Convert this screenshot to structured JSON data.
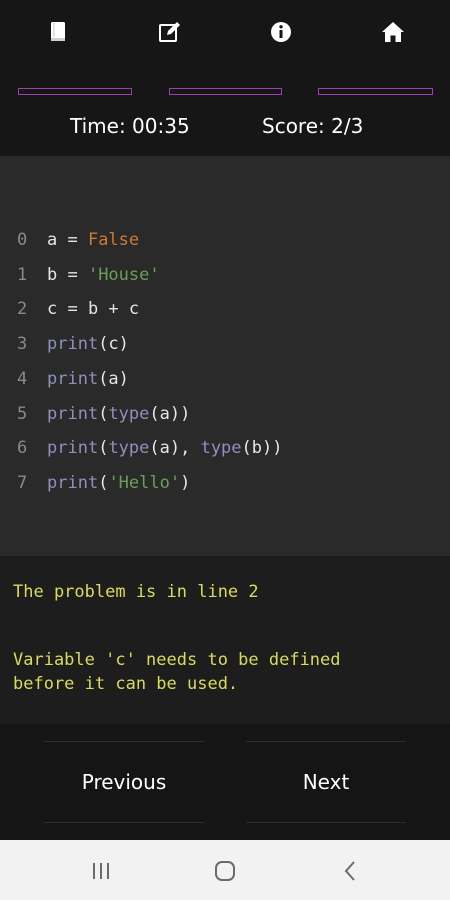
{
  "toolbar": {
    "icons": [
      "book-icon",
      "edit-icon",
      "info-icon",
      "home-icon"
    ]
  },
  "progress": {
    "segments": 3,
    "color": "#9b3fb2"
  },
  "status": {
    "time": "Time: 00:35",
    "score": "Score: 2/3"
  },
  "code": {
    "line_numbers": [
      "0",
      "1",
      "2",
      "3",
      "4",
      "5",
      "6",
      "7"
    ],
    "lines": [
      [
        {
          "t": "a = ",
          "c": "plain"
        },
        {
          "t": "False",
          "c": "kw"
        }
      ],
      [
        {
          "t": "b = ",
          "c": "plain"
        },
        {
          "t": "'House'",
          "c": "str"
        }
      ],
      [
        {
          "t": "c = b + c",
          "c": "plain"
        }
      ],
      [
        {
          "t": "print",
          "c": "fn"
        },
        {
          "t": "(c)",
          "c": "plain"
        }
      ],
      [
        {
          "t": "print",
          "c": "fn"
        },
        {
          "t": "(a)",
          "c": "plain"
        }
      ],
      [
        {
          "t": "print",
          "c": "fn"
        },
        {
          "t": "(",
          "c": "plain"
        },
        {
          "t": "type",
          "c": "fn"
        },
        {
          "t": "(a))",
          "c": "plain"
        }
      ],
      [
        {
          "t": "print",
          "c": "fn"
        },
        {
          "t": "(",
          "c": "plain"
        },
        {
          "t": "type",
          "c": "fn"
        },
        {
          "t": "(a), ",
          "c": "plain"
        },
        {
          "t": "type",
          "c": "fn"
        },
        {
          "t": "(b))",
          "c": "plain"
        }
      ],
      [
        {
          "t": "print",
          "c": "fn"
        },
        {
          "t": "(",
          "c": "plain"
        },
        {
          "t": "'Hello'",
          "c": "str"
        },
        {
          "t": ")",
          "c": "plain"
        }
      ]
    ]
  },
  "feedback": {
    "problem": "The problem is in line 2",
    "explanation_line1": "Variable 'c' needs to be defined",
    "explanation_line2": "before it can be used."
  },
  "nav": {
    "previous_label": "Previous",
    "next_label": "Next"
  },
  "system_nav": {
    "icons": [
      "recents-icon",
      "home-circle-icon",
      "back-icon"
    ]
  }
}
